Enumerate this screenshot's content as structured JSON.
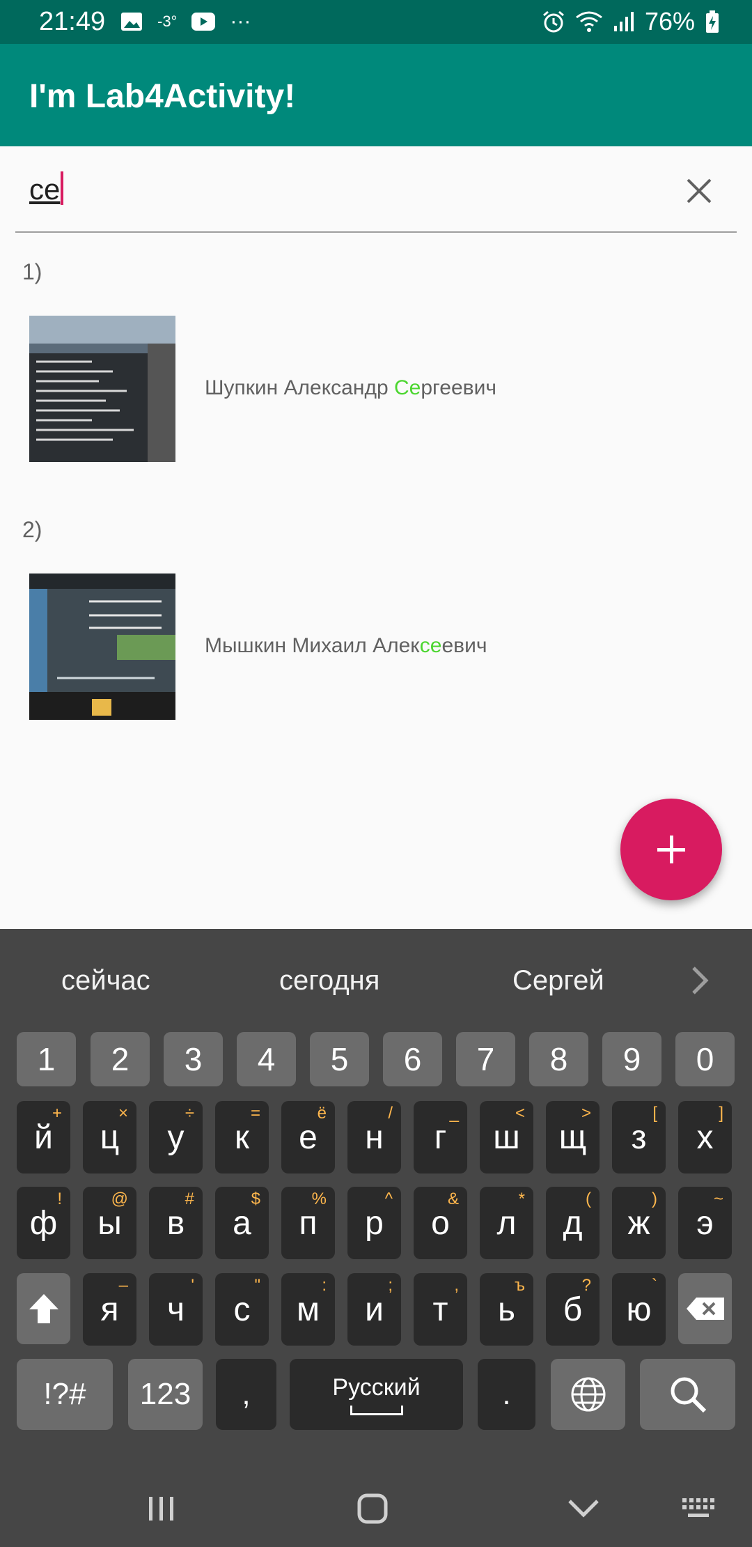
{
  "status_bar": {
    "time": "21:49",
    "temperature": "-3°",
    "more": "···",
    "battery": "76%",
    "icons": [
      "image-icon",
      "youtube-icon",
      "alarm-icon",
      "wifi-icon",
      "signal-icon",
      "battery-charging-icon"
    ]
  },
  "app_bar": {
    "title": "I'm Lab4Activity!"
  },
  "search": {
    "value": "се"
  },
  "items": [
    {
      "index": "1)",
      "name_before": "Шупкин Александр ",
      "name_match": "Се",
      "name_after": "ргеевич"
    },
    {
      "index": "2)",
      "name_before": "Мышкин Михаил Алек",
      "name_match": "се",
      "name_after": "евич"
    }
  ],
  "keyboard": {
    "suggestions": [
      "сейчас",
      "сегодня",
      "Сергей"
    ],
    "num_row": [
      "1",
      "2",
      "3",
      "4",
      "5",
      "6",
      "7",
      "8",
      "9",
      "0"
    ],
    "row1": [
      "й",
      "ц",
      "у",
      "к",
      "е",
      "н",
      "г",
      "ш",
      "щ",
      "з",
      "х"
    ],
    "row1_sup": [
      "+",
      "×",
      "÷",
      "=",
      "ё",
      "/",
      "_",
      "<",
      ">",
      "[",
      "]"
    ],
    "row2": [
      "ф",
      "ы",
      "в",
      "а",
      "п",
      "р",
      "о",
      "л",
      "д",
      "ж",
      "э"
    ],
    "row2_sup": [
      "!",
      "@",
      "#",
      "$",
      "%",
      "^",
      "&",
      "*",
      "(",
      ")",
      "~"
    ],
    "row3": [
      "я",
      "ч",
      "с",
      "м",
      "и",
      "т",
      "ь",
      "б",
      "ю"
    ],
    "row3_sup": [
      "–",
      "'",
      "\"",
      ":",
      ";",
      ",",
      "ъ",
      "?",
      "`"
    ],
    "symbols_label": "!?#",
    "numbers_label": "123",
    "comma": ",",
    "space_label": "Русский",
    "period": "."
  },
  "colors": {
    "status_bar": "#00695c",
    "app_bar": "#00897b",
    "fab": "#d81b60",
    "highlight": "#4cd630",
    "keyboard_bg": "#464646"
  }
}
